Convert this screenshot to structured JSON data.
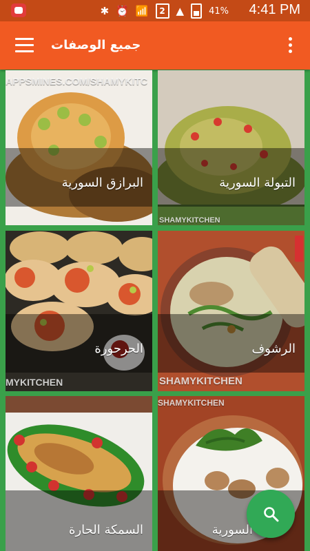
{
  "status_bar": {
    "time": "4:41 PM",
    "battery": "41%",
    "sim_badge": "2",
    "icons": [
      "app-notification-icon",
      "bluetooth-icon",
      "alarm-icon",
      "wifi-icon",
      "signal-icon",
      "battery-icon"
    ]
  },
  "app_bar": {
    "title": "جميع الوصفات",
    "menu_icon": "hamburger-menu-icon",
    "overflow_icon": "vertical-dots-icon"
  },
  "recipes": [
    {
      "label": "التبولة السورية",
      "watermark": "SHAMYKITCHEN"
    },
    {
      "label": "البرازق السورية",
      "watermark": "APPSMINES.COM/SHAMYKITC"
    },
    {
      "label": "الرشوف",
      "watermark": "SHAMYKITCHEN"
    },
    {
      "label": "الحرحورة",
      "watermark": "MYKITCHEN"
    },
    {
      "label": "السورية",
      "watermark": "SHAMYKITCHEN"
    },
    {
      "label": "السمكة الحارة",
      "watermark": ""
    }
  ],
  "fab": {
    "icon": "search-icon"
  },
  "colors": {
    "accent": "#f15a22",
    "status_bar": "#c44a16",
    "fab": "#31a956",
    "grid_background": "#3aa04a"
  }
}
